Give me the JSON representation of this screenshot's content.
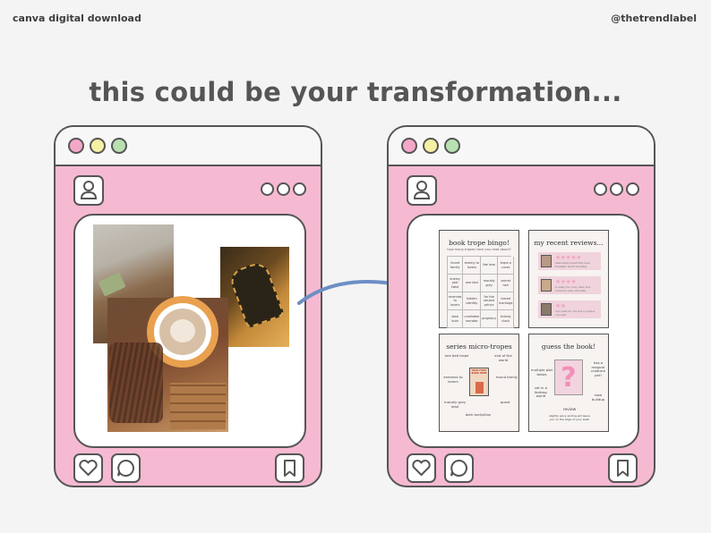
{
  "header": {
    "left_label": "canva digital download",
    "right_label": "@thetrendlabel",
    "headline": "this could be your transformation..."
  },
  "colors": {
    "frame_pink": "#f6b9d2",
    "outline": "#555555",
    "arrow_blue": "#6d8ec4",
    "dot_pink": "#f4a8c8",
    "dot_yellow": "#f6f0a4",
    "dot_green": "#b8e0b0"
  },
  "icons": {
    "profile": "user-icon",
    "more": "more-dots-icon",
    "like": "heart-icon",
    "comment": "comment-icon",
    "save": "bookmark-icon",
    "arrow": "curved-arrow-icon"
  },
  "before": {
    "photos": [
      "cozy-blanket-book-photo",
      "latte-crochet-photo",
      "boots-photo"
    ]
  },
  "after": {
    "cards": {
      "bingo": {
        "title": "book trope bingo!",
        "subtitle": "how many tropes have you read about?",
        "cells": [
          "found family",
          "enemy to lovers",
          "fae love",
          "trope a curse",
          "enemy plot twist",
          "one bed",
          "morally grey",
          "secret heir",
          "enemies to lovers",
          "hidden identity",
          "for the second prince",
          "forced marriage",
          "slow burn",
          "unreliable narrator",
          "prophecy",
          "ticking clock"
        ]
      },
      "reviews": {
        "title": "my recent reviews...",
        "items": [
          {
            "stars": "★★★★★",
            "text": "absolutely loved this one! fantastic world building"
          },
          {
            "stars": "★★★★",
            "text": "a really fun cozy read, the romance was adorable"
          },
          {
            "stars": "★★",
            "text": "not quite for me but a unique concept"
          }
        ]
      },
      "micro": {
        "title": "series micro-tropes",
        "book": "YOUR FIRST BOOK HERE",
        "labels": [
          "one bed trope",
          "end of the world",
          "enemies to lovers",
          "found family",
          "morally grey lead",
          "quest",
          "dark lord/villan"
        ]
      },
      "guess": {
        "title": "guess the book!",
        "mark": "?",
        "labels": [
          "multiple plot twists",
          "has a magical creature pet!",
          "set in a fantasy world",
          "slow buildup"
        ],
        "review_label": "review",
        "review_text": "slightly spicy ending will leave you on the edge of your seat!"
      }
    }
  }
}
